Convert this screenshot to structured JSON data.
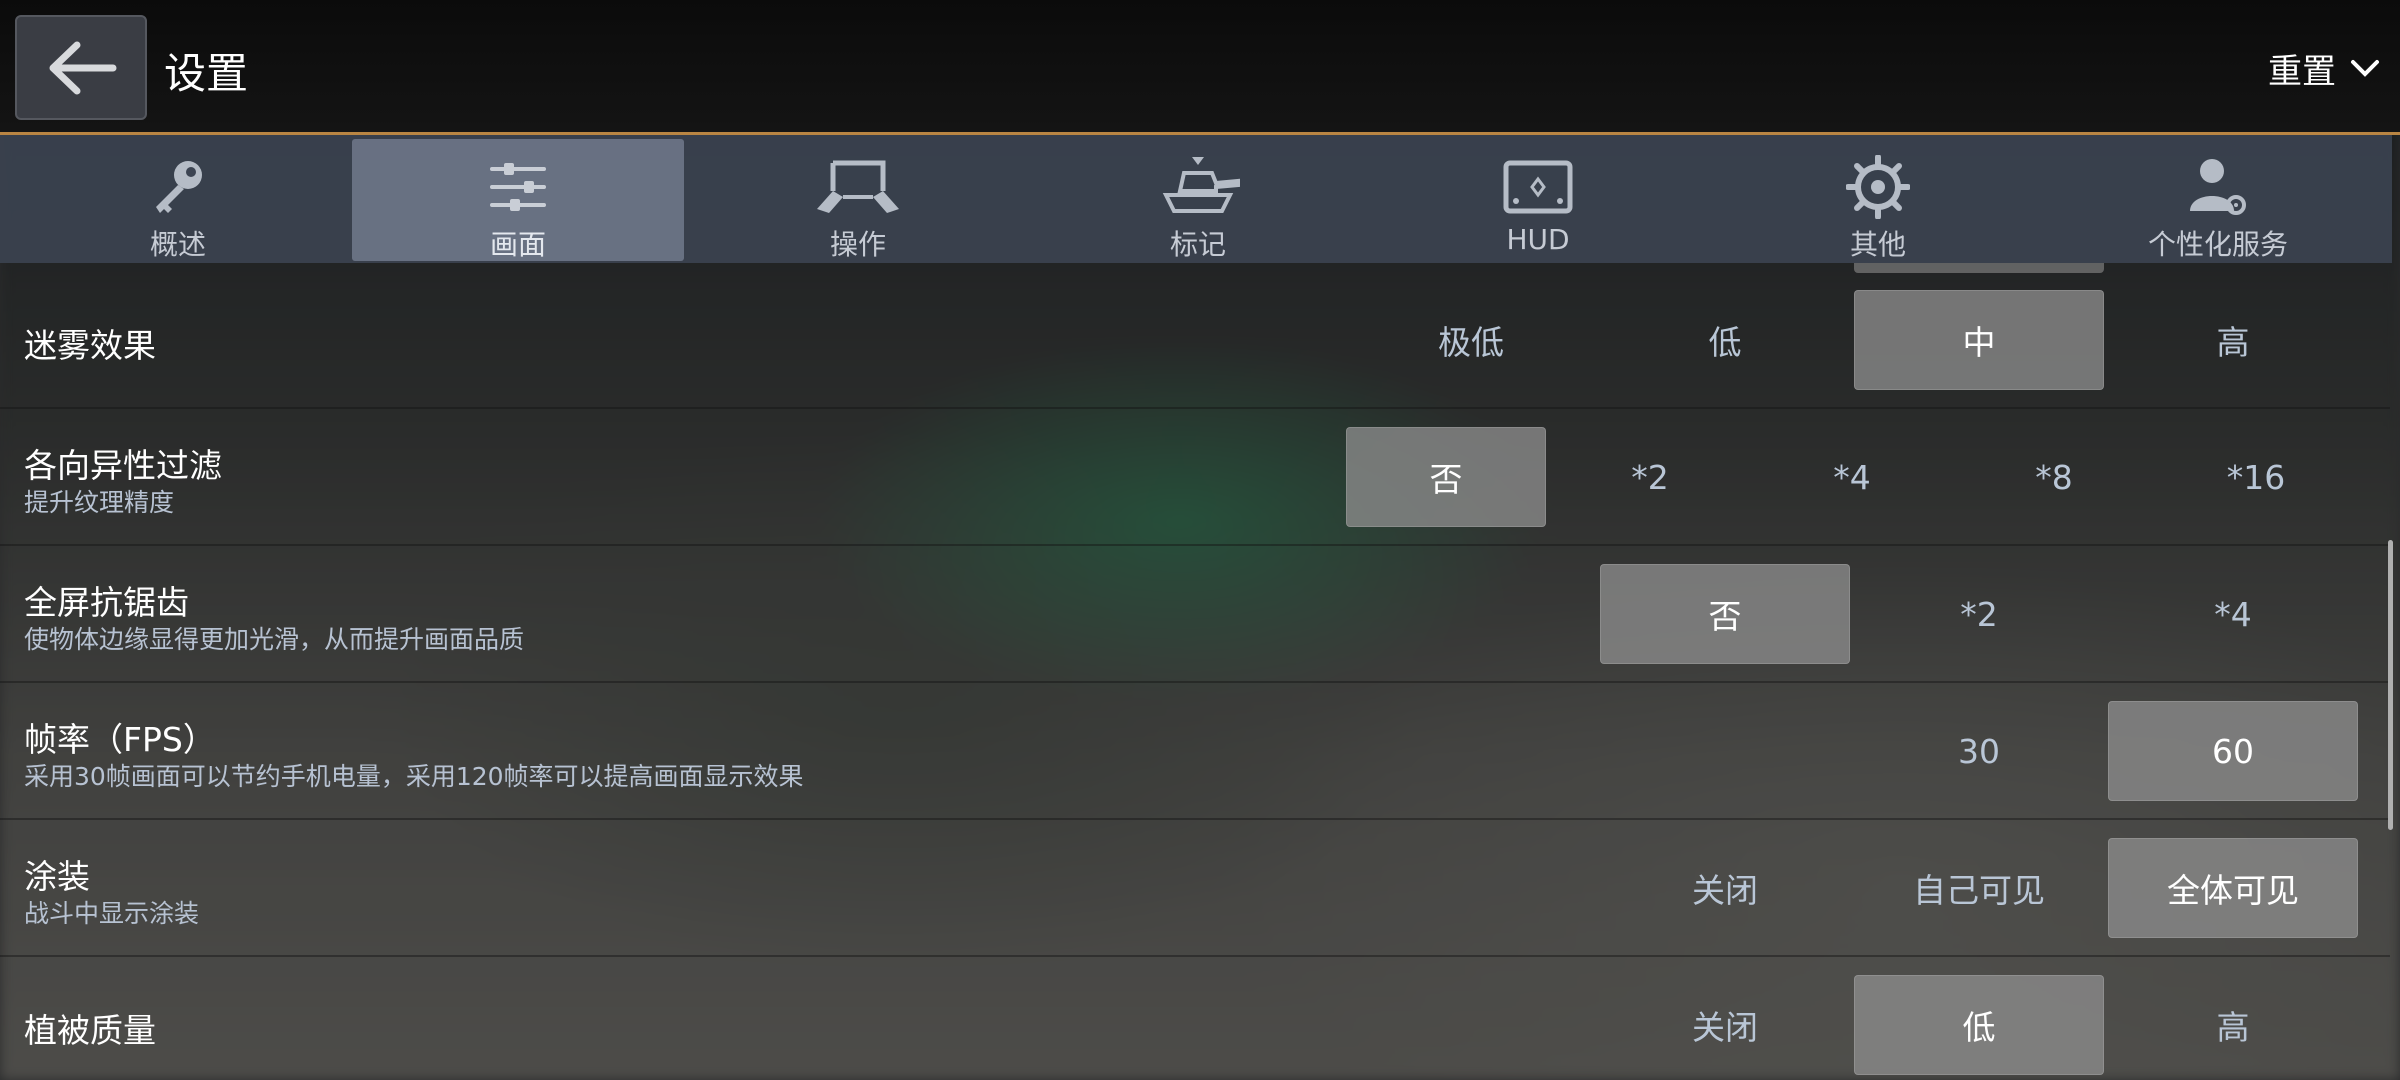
{
  "header": {
    "title": "设置",
    "reset_label": "重置"
  },
  "tabs": [
    {
      "label": "概述",
      "icon": "key-icon",
      "active": false
    },
    {
      "label": "画面",
      "icon": "sliders-icon",
      "active": true
    },
    {
      "label": "操作",
      "icon": "controls-icon",
      "active": false
    },
    {
      "label": "标记",
      "icon": "tank-marker-icon",
      "active": false
    },
    {
      "label": "HUD",
      "icon": "hud-icon",
      "active": false
    },
    {
      "label": "其他",
      "icon": "gear-icon",
      "active": false
    },
    {
      "label": "个性化服务",
      "icon": "user-settings-icon",
      "active": false
    }
  ],
  "settings": [
    {
      "title": "迷雾效果",
      "subtitle": "",
      "options": [
        "极低",
        "低",
        "中",
        "高"
      ],
      "selected": "中"
    },
    {
      "title": "各向异性过滤",
      "subtitle": "提升纹理精度",
      "options": [
        "否",
        "*2",
        "*4",
        "*8",
        "*16"
      ],
      "selected": "否"
    },
    {
      "title": "全屏抗锯齿",
      "subtitle": "使物体边缘显得更加光滑，从而提升画面品质",
      "options": [
        "否",
        "*2",
        "*4"
      ],
      "selected": "否"
    },
    {
      "title": "帧率（FPS）",
      "subtitle": "采用30帧画面可以节约手机电量，采用120帧率可以提高画面显示效果",
      "options": [
        "30",
        "60"
      ],
      "selected": "60"
    },
    {
      "title": "涂装",
      "subtitle": "战斗中显示涂装",
      "options": [
        "关闭",
        "自己可见",
        "全体可见"
      ],
      "selected": "全体可见"
    },
    {
      "title": "植被质量",
      "subtitle": "",
      "options": [
        "关闭",
        "低",
        "高"
      ],
      "selected": "低"
    }
  ]
}
